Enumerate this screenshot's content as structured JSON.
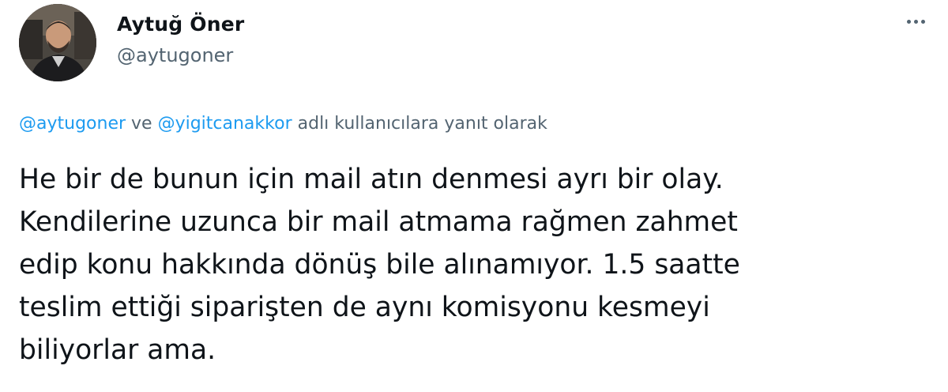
{
  "author": {
    "display_name": "Aytuğ Öner",
    "handle": "@aytugoner"
  },
  "more_icon": "ellipsis-icon",
  "reply_context": {
    "mention_1": "@aytugoner",
    "conjunction": " ve ",
    "mention_2": "@yigitcanakkor",
    "suffix": " adlı kullanıcılara yanıt olarak"
  },
  "tweet_text": "He bir de bunun için mail atın denmesi ayrı bir olay.\nKendilerine uzunca bir mail atmama rağmen zahmet\nedip konu hakkında dönüş bile alınamıyor. 1.5 saatte\nteslim ettiği siparişten de aynı komisyonu kesmeyi\nbiliyorlar ama.",
  "colors": {
    "text_primary": "#0f1419",
    "text_secondary": "#536471",
    "link": "#1d9bf0",
    "background": "#ffffff"
  }
}
